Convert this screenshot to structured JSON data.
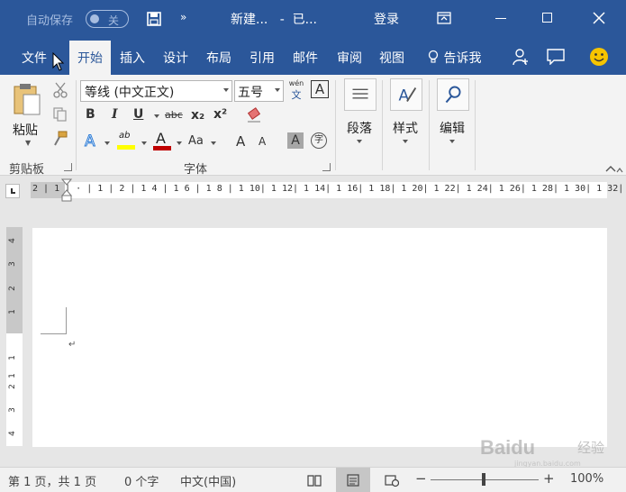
{
  "titlebar": {
    "autosave_label": "自动保存",
    "autosave_state": "关",
    "more": "»",
    "doc_title": "新建...   -  已...",
    "login": "登录"
  },
  "tabs": {
    "file": "文件",
    "home": "开始",
    "insert": "插入",
    "design": "设计",
    "layout": "布局",
    "references": "引用",
    "mailings": "邮件",
    "review": "审阅",
    "view": "视图",
    "tell_me": "告诉我"
  },
  "ribbon": {
    "clipboard": {
      "paste_label": "粘贴",
      "group_label": "剪贴板"
    },
    "font": {
      "font_name": "等线 (中文正文)",
      "font_size": "五号",
      "phonetic_top": "wén",
      "phonetic_bottom": "文",
      "char_border": "A",
      "bold": "B",
      "italic": "I",
      "underline": "U",
      "strikethrough": "abc",
      "subscript": "x₂",
      "superscript": "x²",
      "text_effects": "A",
      "highlight": "ab",
      "font_color": "A",
      "change_case": "Aa",
      "grow_font": "A",
      "shrink_font": "A",
      "char_shading": "A",
      "enclose_char": "字",
      "group_label": "字体"
    },
    "paragraph_label": "段落",
    "styles_label": "样式",
    "editing_label": "编辑"
  },
  "ruler": {
    "horizontal_text": "2 | 1 | · | 1 | 2 | 1 4 | 1 6 | 1 8 | 1 10| 1 12| 1 14| 1 16| 1 18| 1 20| 1 22| 1 24| 1 26| 1 28| 1 30| 1 32| 1 34",
    "vertical_ticks": [
      "4",
      "3",
      "2",
      "1",
      "1",
      "1",
      "2",
      "3",
      "4"
    ]
  },
  "document": {
    "paragraph_mark": "↵"
  },
  "watermark": {
    "brand": "Baidu",
    "sub": "经验",
    "url": "jingyan.baidu.com"
  },
  "statusbar": {
    "page": "第 1 页，共 1 页",
    "words": "0 个字",
    "language": "中文(中国)",
    "zoom_minus": "−",
    "zoom_plus": "+",
    "zoom": "100%"
  },
  "colors": {
    "brand_blue": "#2b579a",
    "highlight_yellow": "#ffff00",
    "font_red": "#c00000"
  }
}
